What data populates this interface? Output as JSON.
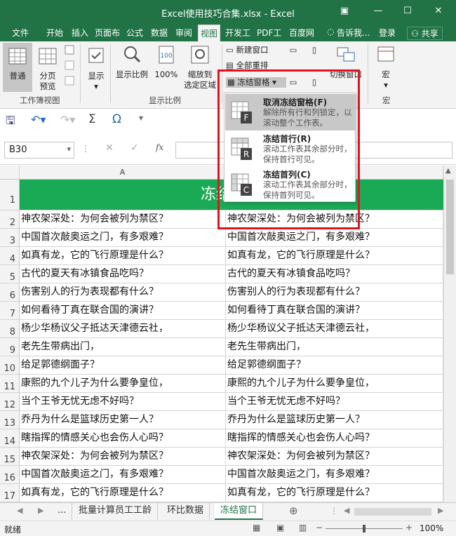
{
  "window": {
    "title": "Excel使用技巧合集.xlsx - Excel"
  },
  "ribbon_tabs": [
    "文件",
    "开始",
    "插入",
    "页面布",
    "公式",
    "数据",
    "审阅",
    "视图",
    "开发工",
    "PDF工",
    "百度网"
  ],
  "ribbon_tabs_right": {
    "tellme": "告诉我...",
    "login": "登录",
    "share": "共享"
  },
  "ribbon": {
    "normal": "普通",
    "page_preview_1": "分页",
    "page_preview_2": "预览",
    "show": "显示",
    "zoom": "显示比例",
    "zoom100": "100%",
    "zoom_sel_1": "缩放到",
    "zoom_sel_2": "选定区域",
    "new_window": "新建窗口",
    "arrange_all": "全部重排",
    "freeze_panes": "冻结窗格",
    "switch_windows": "切换窗口",
    "macros": "宏",
    "group_views": "工作簿视图",
    "group_zoom": "显示比例",
    "group_macros": "宏"
  },
  "freeze_menu": [
    {
      "title": "取消冻结窗格(F)",
      "desc": "解除所有行和列锁定，以滚动整个工作表。",
      "letter": "F"
    },
    {
      "title": "冻结首行(R)",
      "desc": "滚动工作表其余部分时，保持首行可见。",
      "letter": "R"
    },
    {
      "title": "冻结首列(C)",
      "desc": "滚动工作表其余部分时，保持首列可见。",
      "letter": "C"
    }
  ],
  "formula_bar": {
    "name_box": "B30",
    "fx": "fx"
  },
  "sheet": {
    "column_header": "A",
    "header_row_text": "冻结窗口",
    "rows": [
      {
        "n": "2",
        "text": "神农架深处：为何会被列为禁区？"
      },
      {
        "n": "3",
        "text": "中国首次敲奥运之门，有多艰难？"
      },
      {
        "n": "4",
        "text": "如真有龙，它的飞行原理是什么？"
      },
      {
        "n": "5",
        "text": "古代的夏天有冰镇食品吃吗？"
      },
      {
        "n": "6",
        "text": "伤害别人的行为表现都有什么？"
      },
      {
        "n": "7",
        "text": "如何看待丁真在联合国的演讲？"
      },
      {
        "n": "8",
        "text": "杨少华杨议父子抵达天津德云社，"
      },
      {
        "n": "9",
        "text": "老先生带病出门，"
      },
      {
        "n": "10",
        "text": "给足郭德纲面子？"
      },
      {
        "n": "11",
        "text": "康熙的九个儿子为什么要争皇位，"
      },
      {
        "n": "12",
        "text": "当个王爷无忧无虑不好吗？"
      },
      {
        "n": "13",
        "text": "乔丹为什么是篮球历史第一人？"
      },
      {
        "n": "14",
        "text": "瞎指挥的情感关心也会伤人心吗？"
      },
      {
        "n": "15",
        "text": "神农架深处：为何会被列为禁区？"
      },
      {
        "n": "16",
        "text": "中国首次敲奥运之门，有多艰难？"
      },
      {
        "n": "17",
        "text": "如真有龙，它的飞行原理是什么？"
      }
    ]
  },
  "sheet_tabs": [
    "...",
    "批量计算员工工龄",
    "环比数据",
    "冻结窗口"
  ],
  "status": {
    "left": "就绪",
    "zoom": "100%"
  },
  "colors": {
    "excel_green": "#217346",
    "header_fill": "#1aaa55",
    "highlight": "#e0141e"
  }
}
